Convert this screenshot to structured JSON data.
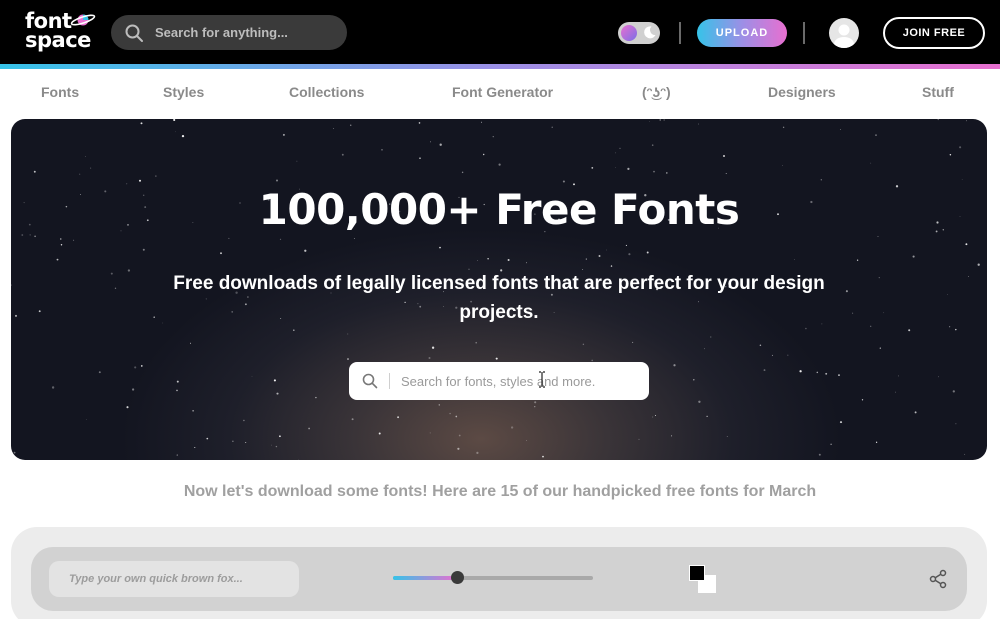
{
  "header": {
    "logo": {
      "line1": "font",
      "line2": "space",
      "icon": "planet-icon"
    },
    "search": {
      "placeholder": "Search for anything...",
      "icon": "search-icon"
    },
    "theme_toggle": {
      "icon": "moon-icon"
    },
    "upload_label": "UPLOAD",
    "avatar_icon": "user-avatar-icon",
    "join_label": "JOIN FREE"
  },
  "nav": {
    "items": [
      {
        "label": "Fonts"
      },
      {
        "label": "Styles"
      },
      {
        "label": "Collections"
      },
      {
        "label": "Font Generator"
      },
      {
        "label": "(ᵔ͜ʖᵔ)"
      },
      {
        "label": "Designers"
      },
      {
        "label": "Stuff"
      }
    ]
  },
  "hero": {
    "title": "100,000+ Free Fonts",
    "subtitle": "Free downloads of legally licensed fonts that are perfect for your design projects.",
    "search": {
      "placeholder": "Search for fonts, styles and more.",
      "icon": "search-icon"
    }
  },
  "tagline": "Now let's download some fonts! Here are 15 of our handpicked free fonts for March",
  "preview": {
    "input_placeholder": "Type your own quick brown fox...",
    "size_slider_fraction": 0.32,
    "foreground_color": "#000000",
    "background_color": "#ffffff",
    "share_icon": "share-icon"
  },
  "colors": {
    "header_bg": "#000000",
    "accent_cyan": "#36c3e8",
    "accent_pink": "#e86fd0",
    "nav_text": "#8a8a8a"
  }
}
